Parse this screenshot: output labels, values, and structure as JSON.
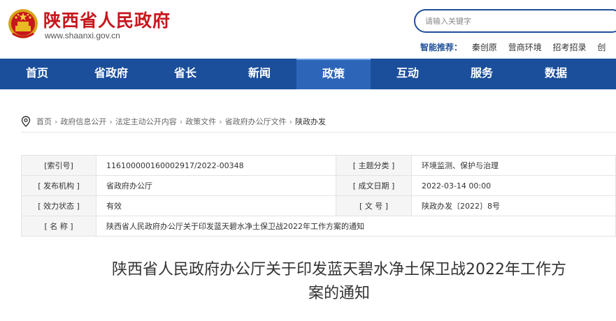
{
  "header": {
    "site_name": "陕西省人民政府",
    "site_url": "www.shaanxi.gov.cn",
    "search_placeholder": "请输入关键字",
    "recommend_label": "智能推荐：",
    "recommend_links": [
      "秦创原",
      "营商环境",
      "招考招录",
      "创"
    ]
  },
  "nav": {
    "items": [
      "首页",
      "省政府",
      "省长",
      "新闻",
      "政策",
      "互动",
      "服务",
      "数据"
    ],
    "active_index": 4
  },
  "breadcrumb": [
    "首页",
    "政府信息公开",
    "法定主动公开内容",
    "政策文件",
    "省政府办公厅文件",
    "陕政办发"
  ],
  "info": {
    "index_label": "[索引号]",
    "index_value": "11610000016000291​7/2022-00348",
    "topic_label": "[ 主题分类 ]",
    "topic_value": "环境监测、保护与治理",
    "publisher_label": "[ 发布机构 ]",
    "publisher_value": "省政府办公厅",
    "date_label": "[ 成文日期 ]",
    "date_value": "2022-03-14 00:00",
    "status_label": "[ 效力状态 ]",
    "status_value": "有效",
    "docno_label": "[ 文  号 ]",
    "docno_value": "陕政办发〔2022〕8号",
    "name_label": "[ 名  称 ]",
    "name_value": "陕西省人民政府办公厅关于印发蓝天碧水净土保卫战2022年工作方案的通知"
  },
  "document": {
    "title_line1": "陕西省人民政府办公厅关于印发蓝天碧水净土保卫战2022年工作方",
    "title_line2": "案的通知"
  },
  "colors": {
    "brand_red": "#c8161d",
    "nav_blue": "#1b4f9b",
    "nav_active": "#2d66b9"
  }
}
